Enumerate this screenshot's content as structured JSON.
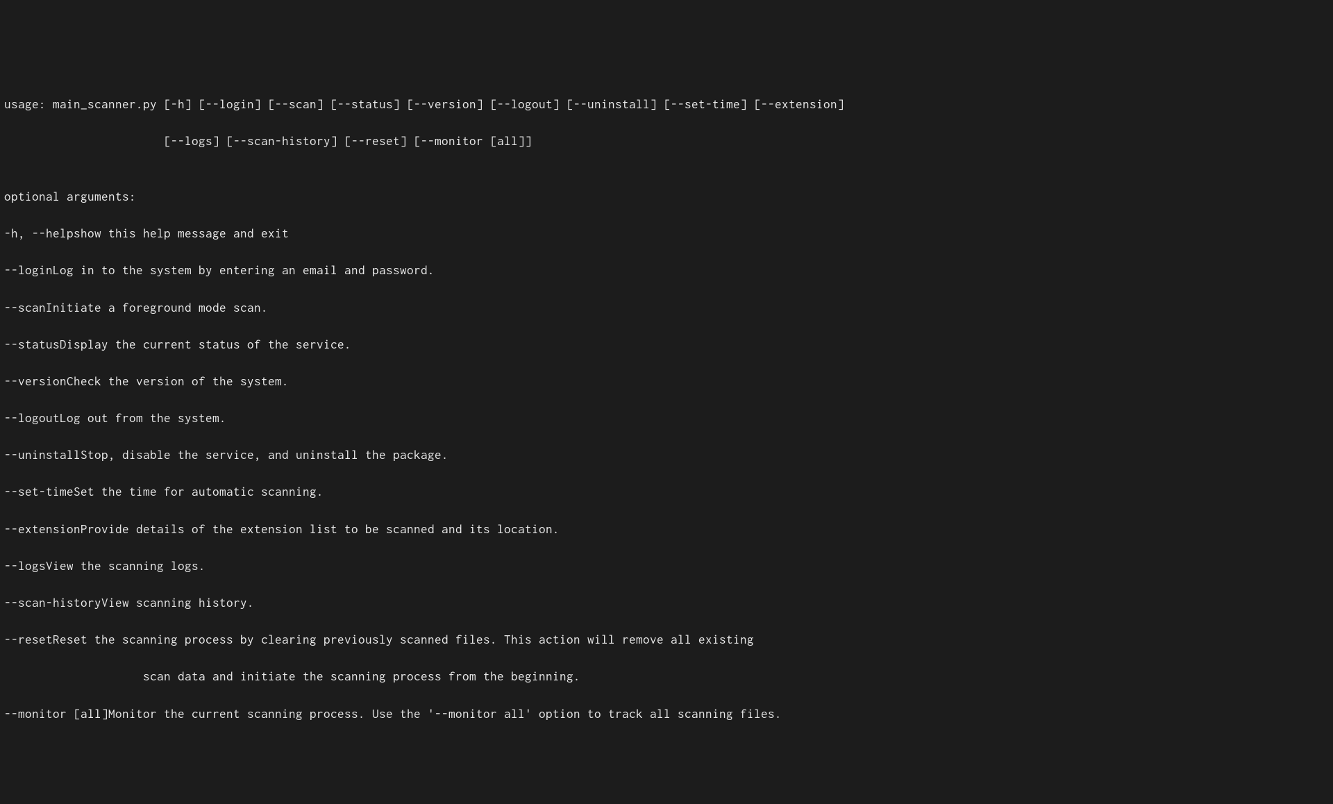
{
  "usage": {
    "line1": "usage: main_scanner.py [-h] [--login] [--scan] [--status] [--version] [--logout] [--uninstall] [--set-time] [--extension]",
    "line2": "                       [--logs] [--scan-history] [--reset] [--monitor [all]]"
  },
  "section_header": "optional arguments:",
  "args": [
    {
      "flag": "-h, --help",
      "desc": "show this help message and exit"
    },
    {
      "flag": "--login",
      "desc": "Log in to the system by entering an email and password."
    },
    {
      "flag": "--scan",
      "desc": "Initiate a foreground mode scan."
    },
    {
      "flag": "--status",
      "desc": "Display the current status of the service."
    },
    {
      "flag": "--version",
      "desc": "Check the version of the system."
    },
    {
      "flag": "--logout",
      "desc": "Log out from the system."
    },
    {
      "flag": "--uninstall",
      "desc": "Stop, disable the service, and uninstall the package."
    },
    {
      "flag": "--set-time",
      "desc": "Set the time for automatic scanning."
    },
    {
      "flag": "--extension",
      "desc": "Provide details of the extension list to be scanned and its location."
    },
    {
      "flag": "--logs",
      "desc": "View the scanning logs."
    },
    {
      "flag": "--scan-history",
      "desc": "View scanning history."
    },
    {
      "flag": "--reset",
      "desc": "Reset the scanning process by clearing previously scanned files. This action will remove all existing"
    }
  ],
  "reset_continuation": "                    scan data and initiate the scanning process from the beginning.",
  "monitor": {
    "flag": "--monitor [all]",
    "desc": "Monitor the current scanning process. Use the '--monitor all' option to track all scanning files."
  }
}
